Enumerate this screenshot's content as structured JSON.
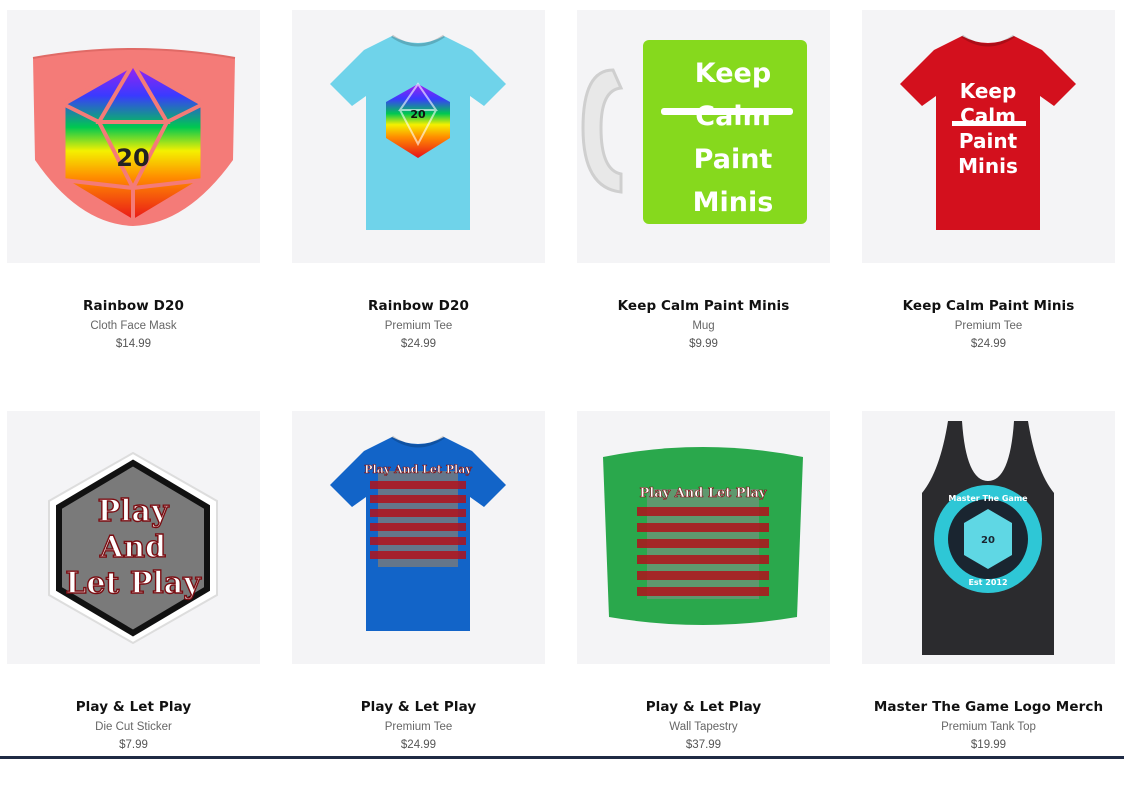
{
  "products": [
    {
      "title": "Rainbow D20",
      "type": "Cloth Face Mask",
      "price": "$14.99",
      "image": {
        "kind": "mask",
        "icon": "rainbow-d20-mask-image",
        "art_text": "20"
      }
    },
    {
      "title": "Rainbow D20",
      "type": "Premium Tee",
      "price": "$24.99",
      "image": {
        "kind": "tee",
        "color": "#6fd3ea",
        "icon": "rainbow-d20-tee-image",
        "art_text": "20"
      }
    },
    {
      "title": "Keep Calm Paint Minis",
      "type": "Mug",
      "price": "$9.99",
      "image": {
        "kind": "mug",
        "color": "#86d91d",
        "icon": "keep-calm-mug-image",
        "art_lines": [
          "Keep",
          "Calm",
          "Paint",
          "Minis"
        ]
      }
    },
    {
      "title": "Keep Calm Paint Minis",
      "type": "Premium Tee",
      "price": "$24.99",
      "image": {
        "kind": "tee",
        "color": "#d3101d",
        "icon": "keep-calm-tee-image",
        "art_lines": [
          "Keep",
          "Calm",
          "Paint",
          "Minis"
        ]
      }
    },
    {
      "title": "Play & Let Play",
      "type": "Die Cut Sticker",
      "price": "$7.99",
      "image": {
        "kind": "sticker",
        "icon": "play-and-let-play-sticker-image",
        "art_lines": [
          "Play",
          "And",
          "Let Play"
        ]
      }
    },
    {
      "title": "Play & Let Play",
      "type": "Premium Tee",
      "price": "$24.99",
      "image": {
        "kind": "tee",
        "color": "#1264c8",
        "icon": "play-and-let-play-tee-image",
        "art_title": "Play And Let Play"
      }
    },
    {
      "title": "Play & Let Play",
      "type": "Wall Tapestry",
      "price": "$37.99",
      "image": {
        "kind": "tapestry",
        "color": "#2aa84c",
        "icon": "play-and-let-play-tapestry-image",
        "art_title": "Play And Let Play"
      }
    },
    {
      "title": "Master The Game Logo Merch",
      "type": "Premium Tank Top",
      "price": "$19.99",
      "image": {
        "kind": "tank",
        "color": "#2b2b2e",
        "icon": "master-the-game-tank-image",
        "art_lines": [
          "Master The Game",
          "20",
          "Est 2012"
        ]
      }
    }
  ]
}
